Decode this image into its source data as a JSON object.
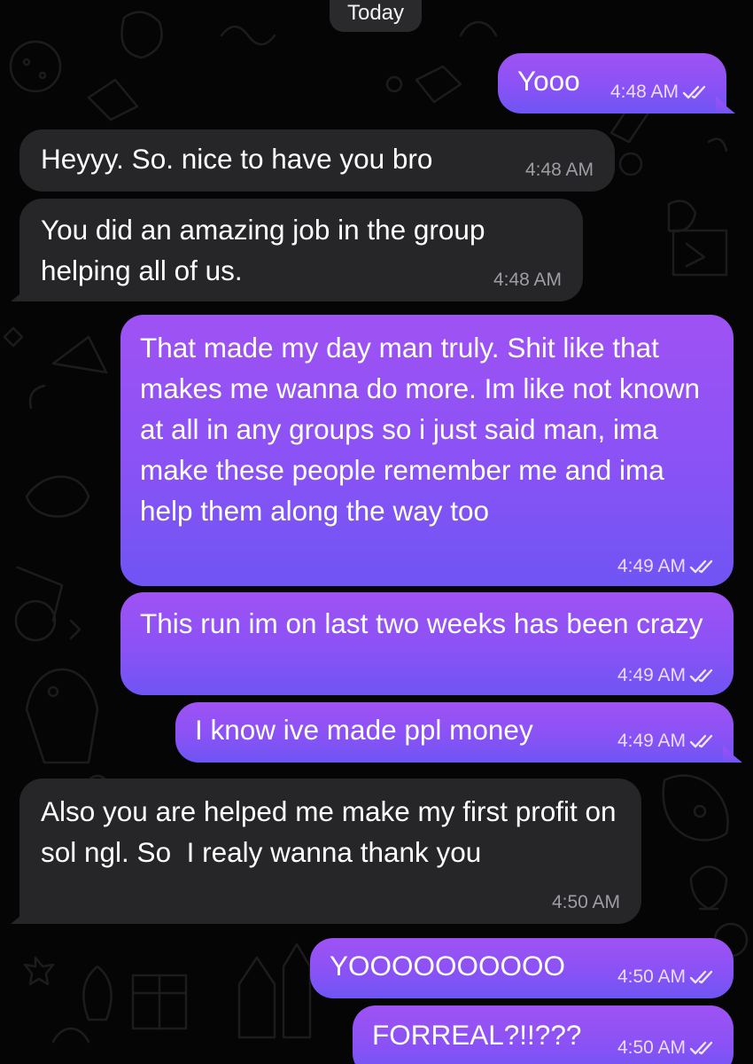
{
  "chat": {
    "date_label": "Today",
    "messages": [
      {
        "direction": "outgoing",
        "text": "Yooo",
        "time": "4:48 AM",
        "status": "read"
      },
      {
        "direction": "incoming",
        "text": "Heyyy. So. nice to have you bro",
        "time": "4:48 AM"
      },
      {
        "direction": "incoming",
        "text": "You did an amazing job in the group helping all of us.",
        "time": "4:48 AM"
      },
      {
        "direction": "outgoing",
        "text": "That made my day man truly. Shit like that makes me wanna do more. Im like not known at all in any groups so i just said man, ima make these people remember me and ima help them along the way too",
        "time": "4:49 AM",
        "status": "read"
      },
      {
        "direction": "outgoing",
        "text": "This run im on last two weeks has been crazy",
        "time": "4:49 AM",
        "status": "read"
      },
      {
        "direction": "outgoing",
        "text": "I know ive made ppl money",
        "time": "4:49 AM",
        "status": "read"
      },
      {
        "direction": "incoming",
        "text": "Also you are helped me make my first profit on sol ngl. So  I realy wanna thank you",
        "time": "4:50 AM"
      },
      {
        "direction": "outgoing",
        "text": "YOOOOOOOOOO",
        "time": "4:50 AM",
        "status": "read"
      },
      {
        "direction": "outgoing",
        "text": "FORREAL?!!???",
        "time": "4:50 AM",
        "status": "read"
      }
    ]
  },
  "colors": {
    "background": "#050505",
    "incoming_bubble": "#262629",
    "outgoing_gradient_top": "#9f52f4",
    "outgoing_gradient_bottom": "#6f55f4",
    "doodle_stroke": "#1c1c1e"
  }
}
